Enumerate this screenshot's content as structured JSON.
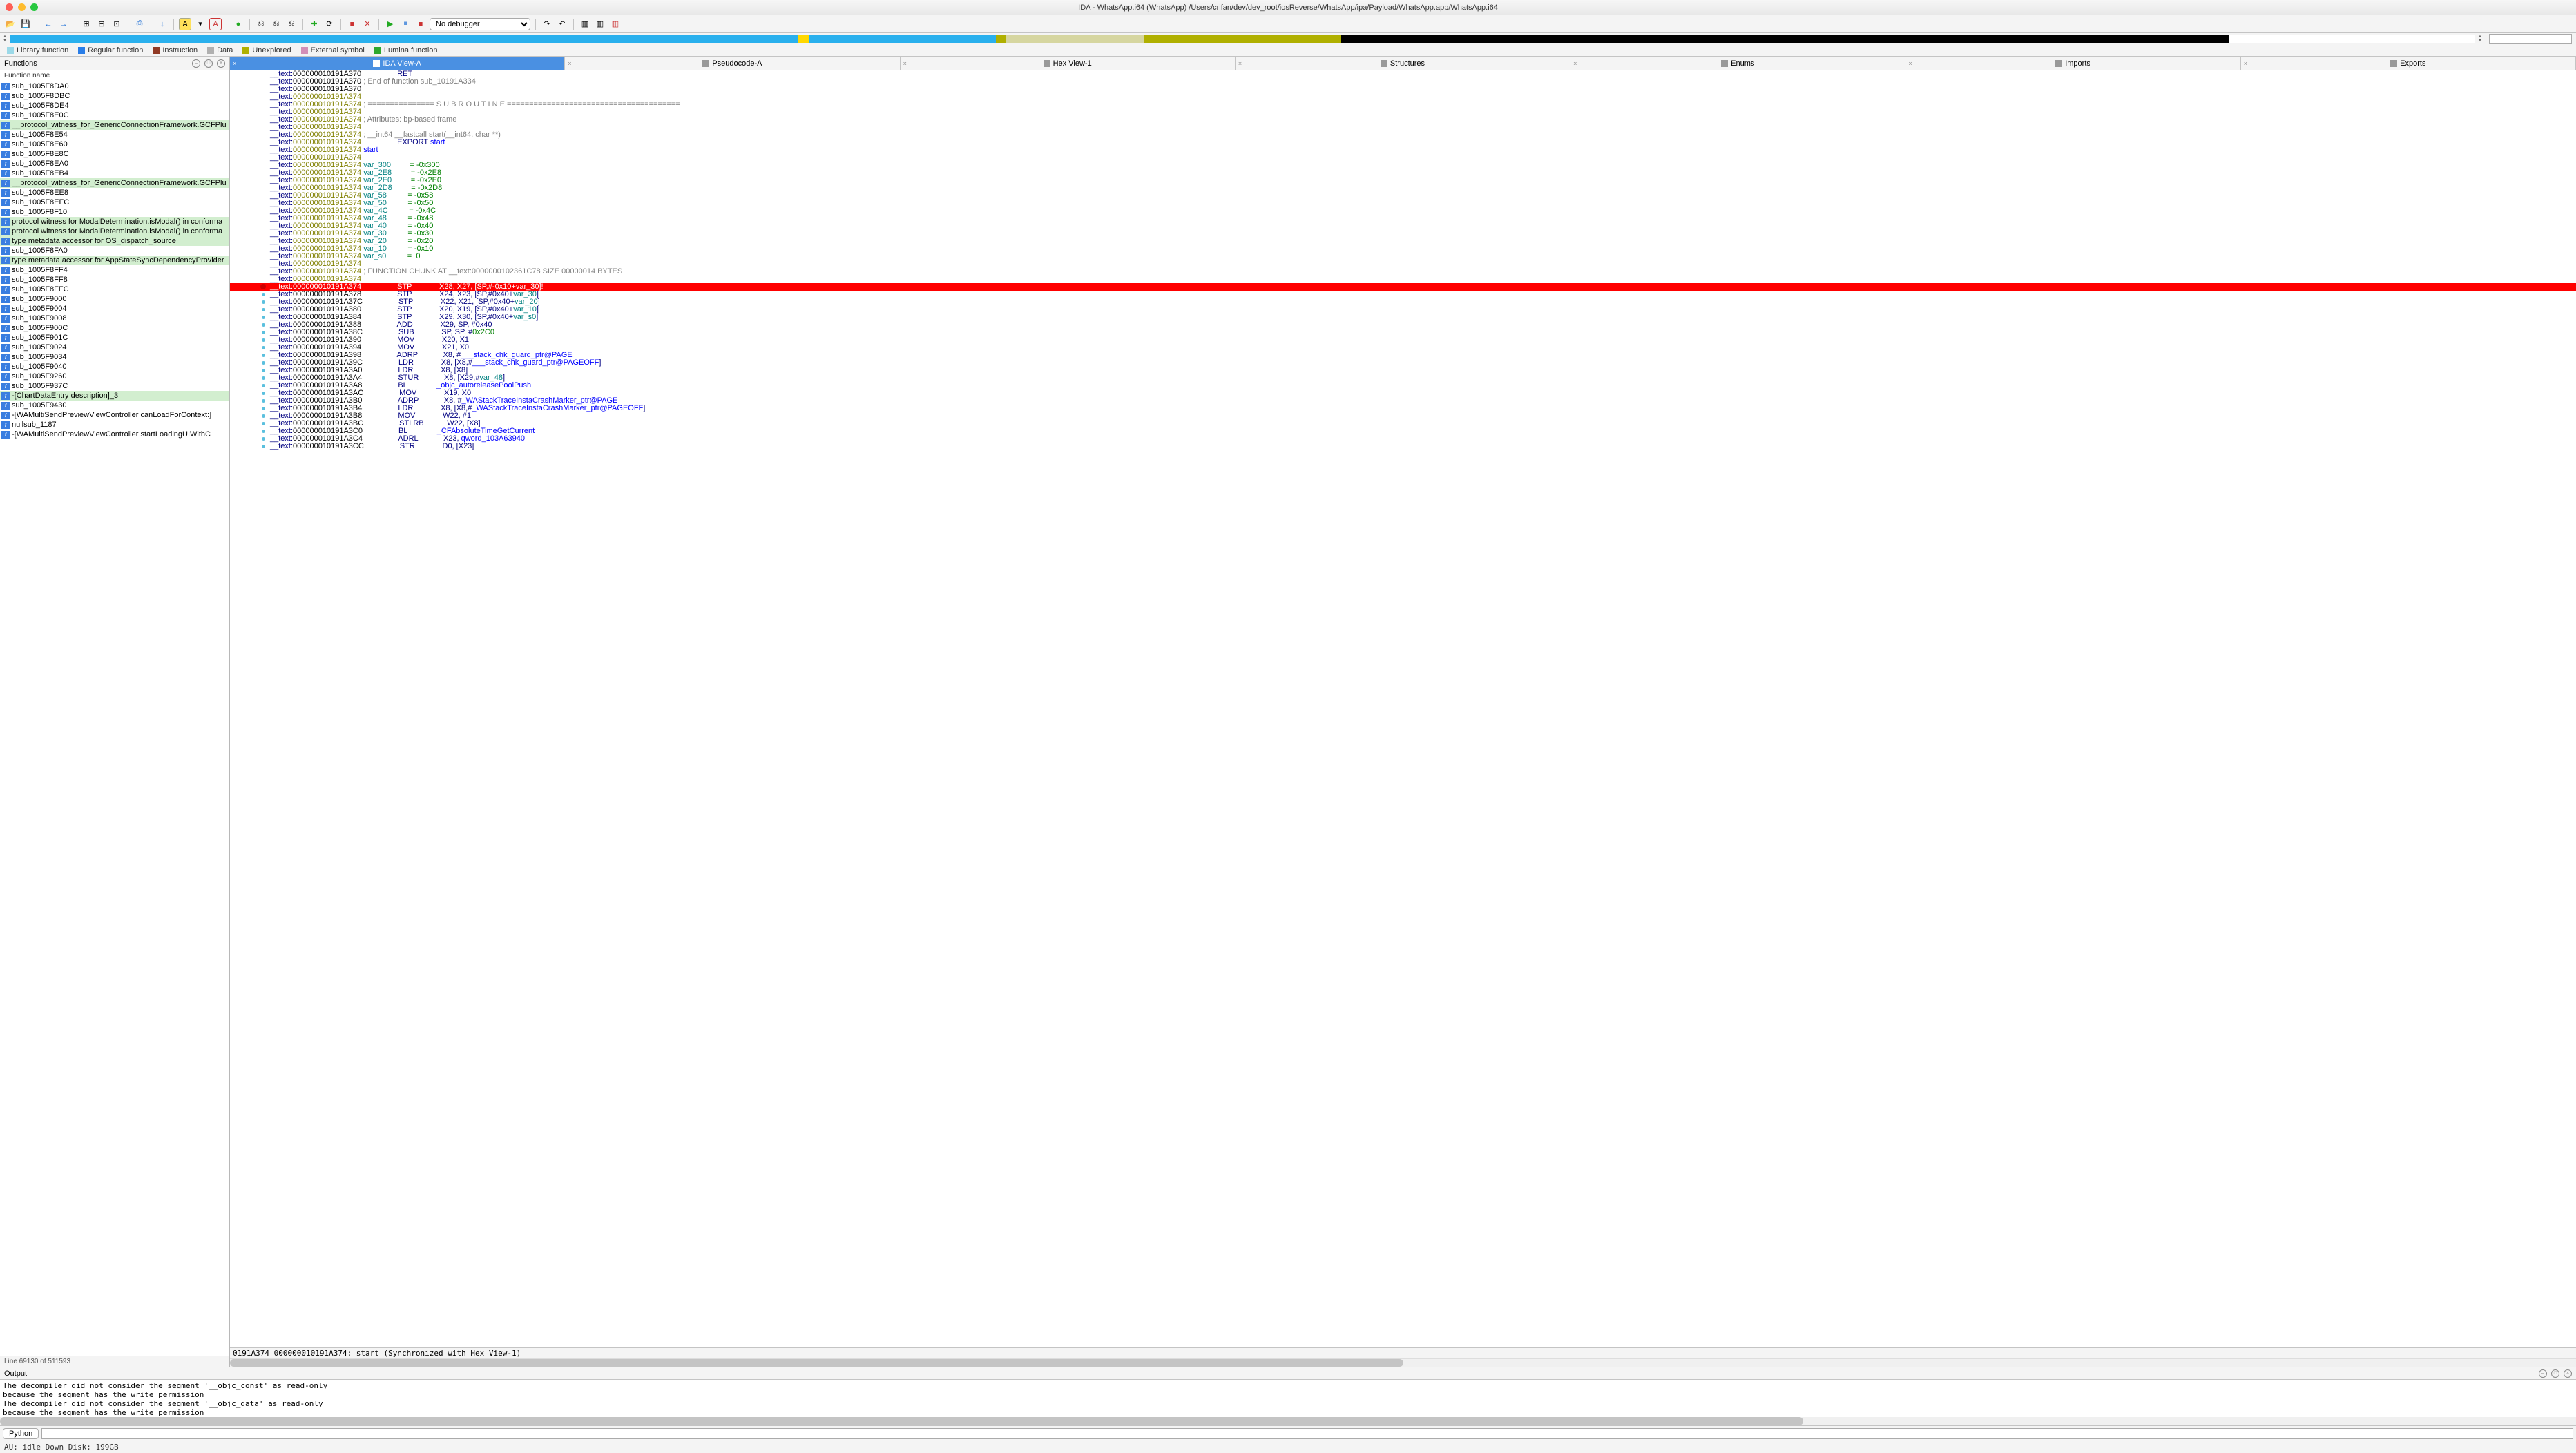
{
  "window": {
    "title": "IDA - WhatsApp.i64 (WhatsApp) /Users/crifan/dev/dev_root/iosReverse/WhatsApp/ipa/Payload/WhatsApp.app/WhatsApp.i64"
  },
  "toolbar": {
    "debugger_select": "No debugger"
  },
  "nav_strip": [
    {
      "color": "#2ab0ed",
      "pct": 32
    },
    {
      "color": "#ffd800",
      "pct": 0.4
    },
    {
      "color": "#2ab0ed",
      "pct": 7.6
    },
    {
      "color": "#b0b000",
      "pct": 0.4
    },
    {
      "color": "#d6d6a0",
      "pct": 5.6
    },
    {
      "color": "#b0b000",
      "pct": 8
    },
    {
      "color": "#000000",
      "pct": 36
    },
    {
      "color": "#ffffff",
      "pct": 10
    }
  ],
  "legend": [
    {
      "color": "#9bd9e8",
      "label": "Library function"
    },
    {
      "color": "#2a7ee8",
      "label": "Regular function"
    },
    {
      "color": "#913a25",
      "label": "Instruction"
    },
    {
      "color": "#b0b0b0",
      "label": "Data"
    },
    {
      "color": "#b0b000",
      "label": "Unexplored"
    },
    {
      "color": "#d48fb8",
      "label": "External symbol"
    },
    {
      "color": "#2ea82e",
      "label": "Lumina function"
    }
  ],
  "side_panel": {
    "title": "Functions",
    "col_header": "Function name",
    "status": "Line 69130 of 511593",
    "functions": [
      {
        "name": "sub_1005F8DA0",
        "hl": false
      },
      {
        "name": "sub_1005F8DBC",
        "hl": false
      },
      {
        "name": "sub_1005F8DE4",
        "hl": false
      },
      {
        "name": "sub_1005F8E0C",
        "hl": false
      },
      {
        "name": "__protocol_witness_for_GenericConnectionFramework.GCFPlu",
        "hl": true
      },
      {
        "name": "sub_1005F8E54",
        "hl": false
      },
      {
        "name": "sub_1005F8E60",
        "hl": false
      },
      {
        "name": "sub_1005F8E8C",
        "hl": false
      },
      {
        "name": "sub_1005F8EA0",
        "hl": false
      },
      {
        "name": "sub_1005F8EB4",
        "hl": false
      },
      {
        "name": "__protocol_witness_for_GenericConnectionFramework.GCFPlu",
        "hl": true
      },
      {
        "name": "sub_1005F8EE8",
        "hl": false
      },
      {
        "name": "sub_1005F8EFC",
        "hl": false
      },
      {
        "name": "sub_1005F8F10",
        "hl": false
      },
      {
        "name": "protocol witness for ModalDetermination.isModal() in conforma",
        "hl": true
      },
      {
        "name": "protocol witness for ModalDetermination.isModal() in conforma",
        "hl": true
      },
      {
        "name": "type metadata accessor for OS_dispatch_source",
        "hl": true
      },
      {
        "name": "sub_1005F8FA0",
        "hl": false
      },
      {
        "name": "type metadata accessor for AppStateSyncDependencyProvider",
        "hl": true
      },
      {
        "name": "sub_1005F8FF4",
        "hl": false
      },
      {
        "name": "sub_1005F8FF8",
        "hl": false
      },
      {
        "name": "sub_1005F8FFC",
        "hl": false
      },
      {
        "name": "sub_1005F9000",
        "hl": false
      },
      {
        "name": "sub_1005F9004",
        "hl": false
      },
      {
        "name": "sub_1005F9008",
        "hl": false
      },
      {
        "name": "sub_1005F900C",
        "hl": false
      },
      {
        "name": "sub_1005F901C",
        "hl": false
      },
      {
        "name": "sub_1005F9024",
        "hl": false
      },
      {
        "name": "sub_1005F9034",
        "hl": false
      },
      {
        "name": "sub_1005F9040",
        "hl": false
      },
      {
        "name": "sub_1005F9260",
        "hl": false
      },
      {
        "name": "sub_1005F937C",
        "hl": false
      },
      {
        "name": "-[ChartDataEntry description]_3",
        "hl": true
      },
      {
        "name": "sub_1005F9430",
        "hl": false
      },
      {
        "name": "-[WAMultiSendPreviewViewController canLoadForContext:]",
        "hl": false
      },
      {
        "name": "nullsub_1187",
        "hl": false
      },
      {
        "name": "-[WAMultiSendPreviewViewController startLoadingUIWithC",
        "hl": false
      }
    ]
  },
  "tabs": [
    {
      "label": "IDA View-A",
      "active": true
    },
    {
      "label": "Pseudocode-A",
      "active": false
    },
    {
      "label": "Hex View-1",
      "active": false
    },
    {
      "label": "Structures",
      "active": false
    },
    {
      "label": "Enums",
      "active": false
    },
    {
      "label": "Imports",
      "active": false
    },
    {
      "label": "Exports",
      "active": false
    }
  ],
  "disasm_status": "0191A374 000000010191A374: start (Synchronized with Hex View-1)",
  "disasm": [
    {
      "a": "000000010191A370",
      "ak": false,
      "op": "RET",
      "args": ""
    },
    {
      "a": "000000010191A370",
      "ak": false,
      "cmt": "; End of function sub_10191A334"
    },
    {
      "a": "000000010191A370",
      "ak": false
    },
    {
      "a": "000000010191A374",
      "ak": true
    },
    {
      "a": "000000010191A374",
      "ak": true,
      "cmt": "; =============== S U B R O U T I N E ======================================="
    },
    {
      "a": "000000010191A374",
      "ak": true
    },
    {
      "a": "000000010191A374",
      "ak": true,
      "cmt": "; Attributes: bp-based frame"
    },
    {
      "a": "000000010191A374",
      "ak": true
    },
    {
      "a": "000000010191A374",
      "ak": true,
      "cmt": "; __int64 __fastcall start(__int64, char **)"
    },
    {
      "a": "000000010191A374",
      "ak": true,
      "export": "EXPORT start"
    },
    {
      "a": "000000010191A374",
      "ak": true,
      "start": "start"
    },
    {
      "a": "000000010191A374",
      "ak": true
    },
    {
      "a": "000000010191A374",
      "ak": true,
      "var": "var_300",
      "eq": "= -0x300"
    },
    {
      "a": "000000010191A374",
      "ak": true,
      "var": "var_2E8",
      "eq": "= -0x2E8"
    },
    {
      "a": "000000010191A374",
      "ak": true,
      "var": "var_2E0",
      "eq": "= -0x2E0"
    },
    {
      "a": "000000010191A374",
      "ak": true,
      "var": "var_2D8",
      "eq": "= -0x2D8"
    },
    {
      "a": "000000010191A374",
      "ak": true,
      "var": "var_58",
      "eq": "= -0x58"
    },
    {
      "a": "000000010191A374",
      "ak": true,
      "var": "var_50",
      "eq": "= -0x50"
    },
    {
      "a": "000000010191A374",
      "ak": true,
      "var": "var_4C",
      "eq": "= -0x4C"
    },
    {
      "a": "000000010191A374",
      "ak": true,
      "var": "var_48",
      "eq": "= -0x48"
    },
    {
      "a": "000000010191A374",
      "ak": true,
      "var": "var_40",
      "eq": "= -0x40"
    },
    {
      "a": "000000010191A374",
      "ak": true,
      "var": "var_30",
      "eq": "= -0x30"
    },
    {
      "a": "000000010191A374",
      "ak": true,
      "var": "var_20",
      "eq": "= -0x20"
    },
    {
      "a": "000000010191A374",
      "ak": true,
      "var": "var_10",
      "eq": "= -0x10"
    },
    {
      "a": "000000010191A374",
      "ak": true,
      "var": "var_s0",
      "eq": "=  0"
    },
    {
      "a": "000000010191A374",
      "ak": true
    },
    {
      "a": "000000010191A374",
      "ak": true,
      "cmt": "; FUNCTION CHUNK AT __text:0000000102361C78 SIZE 00000014 BYTES"
    },
    {
      "a": "000000010191A374",
      "ak": true
    },
    {
      "a": "000000010191A374",
      "ak": true,
      "bp": true,
      "hl": true,
      "op": "STP",
      "args": "X28, X27, [SP,#-0x10+var_30]!"
    },
    {
      "a": "000000010191A378",
      "ak": false,
      "dot": true,
      "op": "STP",
      "args_raw": "X24, X23, [SP,#0x40+",
      "argvar": "var_30",
      "args_tail": "]"
    },
    {
      "a": "000000010191A37C",
      "ak": false,
      "dot": true,
      "op": "STP",
      "args_raw": "X22, X21, [SP,#0x40+",
      "argvar": "var_20",
      "args_tail": "]"
    },
    {
      "a": "000000010191A380",
      "ak": false,
      "dot": true,
      "op": "STP",
      "args_raw": "X20, X19, [SP,#0x40+",
      "argvar": "var_10",
      "args_tail": "]"
    },
    {
      "a": "000000010191A384",
      "ak": false,
      "dot": true,
      "op": "STP",
      "args_raw": "X29, X30, [SP,#0x40+",
      "argvar": "var_s0",
      "args_tail": "]"
    },
    {
      "a": "000000010191A388",
      "ak": false,
      "dot": true,
      "op": "ADD",
      "args_raw": "X29, SP, #0x40"
    },
    {
      "a": "000000010191A38C",
      "ak": false,
      "dot": true,
      "op": "SUB",
      "args_raw": "SP, SP, #",
      "argnum": "0x2C0"
    },
    {
      "a": "000000010191A390",
      "ak": false,
      "dot": true,
      "op": "MOV",
      "args_raw": "X20, X1"
    },
    {
      "a": "000000010191A394",
      "ak": false,
      "dot": true,
      "op": "MOV",
      "args_raw": "X21, X0"
    },
    {
      "a": "000000010191A398",
      "ak": false,
      "dot": true,
      "op": "ADRP",
      "args_raw": "X8, #",
      "argsym": "___stack_chk_guard_ptr@PAGE"
    },
    {
      "a": "000000010191A39C",
      "ak": false,
      "dot": true,
      "op": "LDR",
      "args_raw": "X8, [X8,#",
      "argsym": "___stack_chk_guard_ptr@PAGEOFF",
      "args_tail": "]"
    },
    {
      "a": "000000010191A3A0",
      "ak": false,
      "dot": true,
      "op": "LDR",
      "args_raw": "X8, [X8]"
    },
    {
      "a": "000000010191A3A4",
      "ak": false,
      "dot": true,
      "op": "STUR",
      "args_raw": "X8, [X29,#",
      "argvar": "var_48",
      "args_tail": "]"
    },
    {
      "a": "000000010191A3A8",
      "ak": false,
      "dot": true,
      "op": "BL",
      "argsym": "_objc_autoreleasePoolPush"
    },
    {
      "a": "000000010191A3AC",
      "ak": false,
      "dot": true,
      "op": "MOV",
      "args_raw": "X19, X0"
    },
    {
      "a": "000000010191A3B0",
      "ak": false,
      "dot": true,
      "op": "ADRP",
      "args_raw": "X8, #",
      "argsym": "_WAStackTraceInstaCrashMarker_ptr@PAGE"
    },
    {
      "a": "000000010191A3B4",
      "ak": false,
      "dot": true,
      "op": "LDR",
      "args_raw": "X8, [X8,#",
      "argsym": "_WAStackTraceInstaCrashMarker_ptr@PAGEOFF",
      "args_tail": "]"
    },
    {
      "a": "000000010191A3B8",
      "ak": false,
      "dot": true,
      "op": "MOV",
      "args_raw": "W22, #1"
    },
    {
      "a": "000000010191A3BC",
      "ak": false,
      "dot": true,
      "op": "STLRB",
      "args_raw": "W22, [X8]"
    },
    {
      "a": "000000010191A3C0",
      "ak": false,
      "dot": true,
      "op": "BL",
      "argsym": "_CFAbsoluteTimeGetCurrent"
    },
    {
      "a": "000000010191A3C4",
      "ak": false,
      "dot": true,
      "op": "ADRL",
      "args_raw": "X23, ",
      "argsym": "qword_103A63940"
    },
    {
      "a": "000000010191A3CC",
      "ak": false,
      "dot": true,
      "op": "STR",
      "args_raw": "D0, [X23]"
    }
  ],
  "output": {
    "title": "Output",
    "lines": [
      "The decompiler did not consider the segment '__objc_const' as read-only",
      "because the segment has the write permission",
      "The decompiler did not consider the segment '__objc_data' as read-only",
      "because the segment has the write permission"
    ]
  },
  "cmdline": {
    "label": "Python"
  },
  "bottom_status": "AU:  idle   Down     Disk: 199GB"
}
